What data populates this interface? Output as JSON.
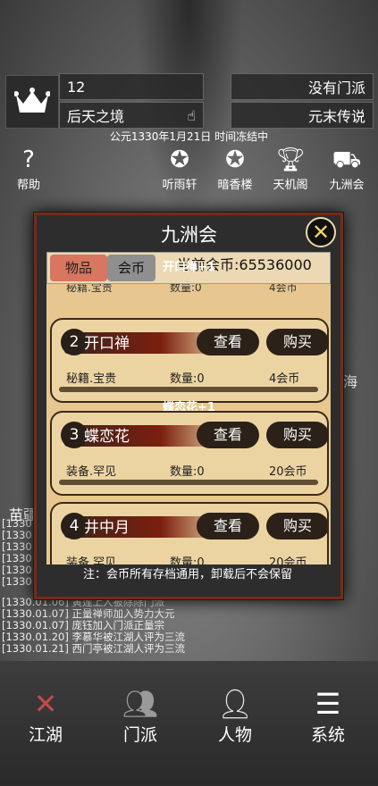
{
  "header": {
    "level": "12",
    "realm": "后天之境",
    "sect": "没有门派",
    "title": "元末传说",
    "date_line": "公元1330年1月21日 时间冻结中"
  },
  "nav": [
    {
      "label": "帮助",
      "icon": "question-icon"
    },
    {
      "label": "听雨轩",
      "icon": "medal-icon"
    },
    {
      "label": "暗香楼",
      "icon": "medal-icon"
    },
    {
      "label": "天机阁",
      "icon": "trophy-icon"
    },
    {
      "label": "九洲会",
      "icon": "cart-icon"
    }
  ],
  "map": {
    "label_left": "苗疆",
    "label_right": "海"
  },
  "modal": {
    "title": "九洲会",
    "tab_items": "物品",
    "tab_coins": "会币",
    "coins_label": "当前会币:65536000",
    "top_toast": "开口禅+1",
    "partial_row": {
      "meta1": "秘籍.宝贵",
      "meta2": "数量:0",
      "meta3": "4会币"
    },
    "items": [
      {
        "num": "2",
        "name": "开口禅",
        "view": "查看",
        "buy": "购买",
        "type": "秘籍.宝贵",
        "qty": "数量:0",
        "price": "4会币"
      },
      {
        "num": "3",
        "name": "蝶恋花",
        "view": "查看",
        "buy": "购买",
        "type": "装备.罕见",
        "qty": "数量:0",
        "price": "20会币"
      },
      {
        "num": "4",
        "name": "井中月",
        "view": "查看",
        "buy": "购买",
        "type": "装备.罕见",
        "qty": "数量:0",
        "price": "20会币"
      }
    ],
    "toast_2": "蝶恋花+1",
    "note": "注：会币所有存档通用，卸载后不会保留"
  },
  "log": [
    "[1330.0",
    "[1330.0",
    "[1330.0",
    "[1330.0",
    "[1330.0",
    "[1330.0",
    "[1330.01.06] 黄莲上人被除除门派",
    "[1330.01.07] 正量禅师加入势力大元",
    "[1330.01.07] 庞钰加入门派正量宗",
    "[1330.01.20] 李慕华被江湖人评为三流",
    "[1330.01.21] 西门亭被江湖人评为三流"
  ],
  "bottom_nav": [
    {
      "label": "江湖",
      "icon": "crossed-swords-icon"
    },
    {
      "label": "门派",
      "icon": "people-icon"
    },
    {
      "label": "人物",
      "icon": "person-icon"
    },
    {
      "label": "系统",
      "icon": "list-icon"
    }
  ]
}
